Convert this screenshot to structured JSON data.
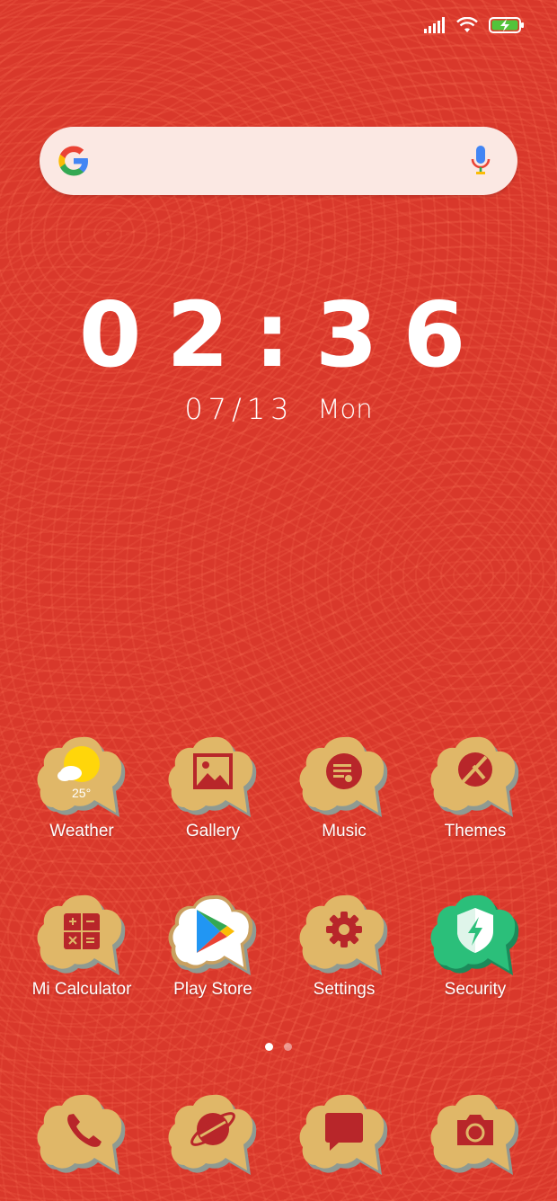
{
  "colors": {
    "wallpaper": "#d9382b",
    "icon_gold": "#e0b768",
    "icon_shadow": "#8f9a92",
    "icon_glyph": "#b8262a",
    "security_green": "#2bbf7a"
  },
  "status_bar": {
    "icons": [
      "signal-icon",
      "wifi-icon",
      "battery-charging-icon"
    ]
  },
  "search": {
    "icons": [
      "google-logo-icon",
      "microphone-icon"
    ]
  },
  "clock": {
    "time": "02:36",
    "date": "07/13",
    "day": "Mon"
  },
  "apps": [
    {
      "label": "Weather",
      "icon": "weather-icon",
      "temperature": "25°"
    },
    {
      "label": "Gallery",
      "icon": "gallery-icon"
    },
    {
      "label": "Music",
      "icon": "music-icon"
    },
    {
      "label": "Themes",
      "icon": "themes-icon"
    },
    {
      "label": "Mi Calculator",
      "icon": "calculator-icon"
    },
    {
      "label": "Play Store",
      "icon": "play-store-icon"
    },
    {
      "label": "Settings",
      "icon": "settings-gear-icon"
    },
    {
      "label": "Security",
      "icon": "security-shield-icon"
    }
  ],
  "page_indicator": {
    "pages": 2,
    "active": 1
  },
  "dock": [
    {
      "icon": "phone-icon"
    },
    {
      "icon": "browser-icon"
    },
    {
      "icon": "messages-icon"
    },
    {
      "icon": "camera-icon"
    }
  ]
}
